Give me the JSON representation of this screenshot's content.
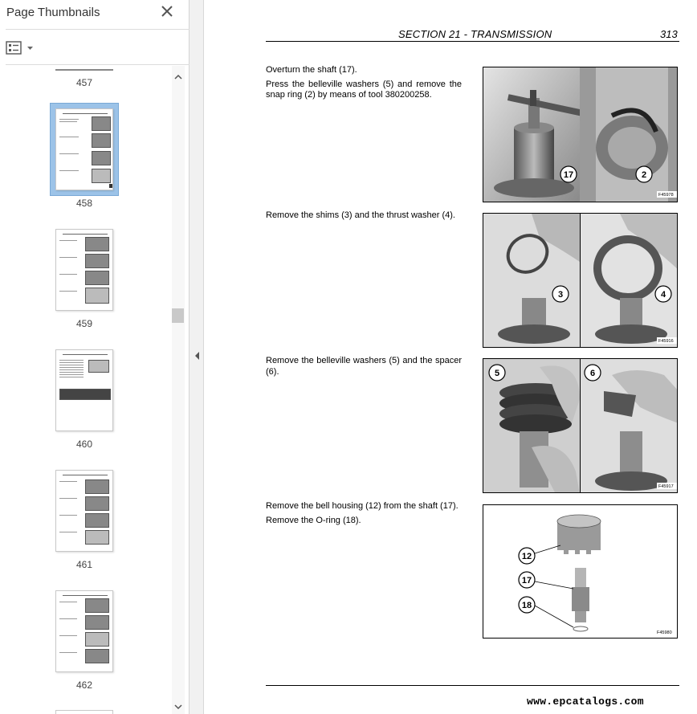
{
  "sidebar": {
    "title": "Page Thumbnails",
    "close_icon": "close-icon",
    "options_icon": "thumbnail-options-icon",
    "thumbnails": [
      {
        "label": "457",
        "selected": false
      },
      {
        "label": "458",
        "selected": true
      },
      {
        "label": "459",
        "selected": false
      },
      {
        "label": "460",
        "selected": false
      },
      {
        "label": "461",
        "selected": false
      },
      {
        "label": "462",
        "selected": false
      }
    ]
  },
  "document": {
    "section": "SECTION 21 - TRANSMISSION",
    "page_number": "313",
    "steps": [
      {
        "lines": [
          "Overturn the shaft (17).",
          "Press the belleville washers (5) and remove the snap ring (2) by means of tool 380200258."
        ],
        "figure_code": "F45978",
        "callouts": [
          "17",
          "2"
        ]
      },
      {
        "lines": [
          "Remove the shims (3) and the thrust washer (4)."
        ],
        "figure_code": "F45916",
        "callouts": [
          "3",
          "4"
        ]
      },
      {
        "lines": [
          "Remove the belleville washers (5) and the spacer (6)."
        ],
        "figure_code": "F45917",
        "callouts": [
          "5",
          "6"
        ]
      },
      {
        "lines": [
          "Remove the bell housing (12) from the shaft (17).",
          "Remove the O-ring (18)."
        ],
        "figure_code": "F45980",
        "callouts": [
          "12",
          "17",
          "18"
        ]
      }
    ],
    "watermark": "www.epcatalogs.com"
  },
  "colors": {
    "selection": "#9cc3e8",
    "sidebar_border": "#d4d4d4",
    "text": "#000000"
  }
}
